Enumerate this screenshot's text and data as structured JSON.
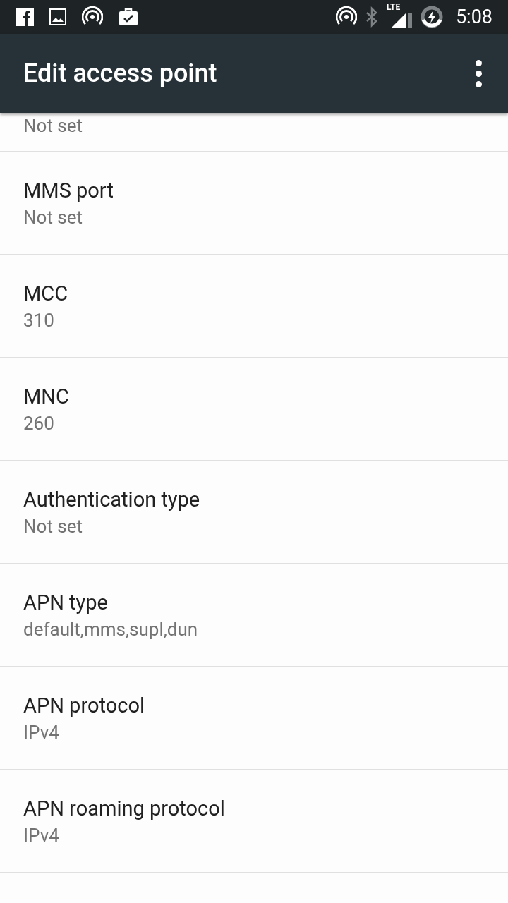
{
  "status_bar": {
    "time": "5:08",
    "network_label": "LTE"
  },
  "app_bar": {
    "title": "Edit access point"
  },
  "preferences": [
    {
      "summary": "Not set",
      "partial": true
    },
    {
      "title": "MMS port",
      "summary": "Not set",
      "partial": false
    },
    {
      "title": "MCC",
      "summary": "310",
      "partial": false
    },
    {
      "title": "MNC",
      "summary": "260",
      "partial": false
    },
    {
      "title": "Authentication type",
      "summary": "Not set",
      "partial": false
    },
    {
      "title": "APN type",
      "summary": "default,mms,supl,dun",
      "partial": false
    },
    {
      "title": "APN protocol",
      "summary": "IPv4",
      "partial": false
    },
    {
      "title": "APN roaming protocol",
      "summary": "IPv4",
      "partial": false
    }
  ]
}
